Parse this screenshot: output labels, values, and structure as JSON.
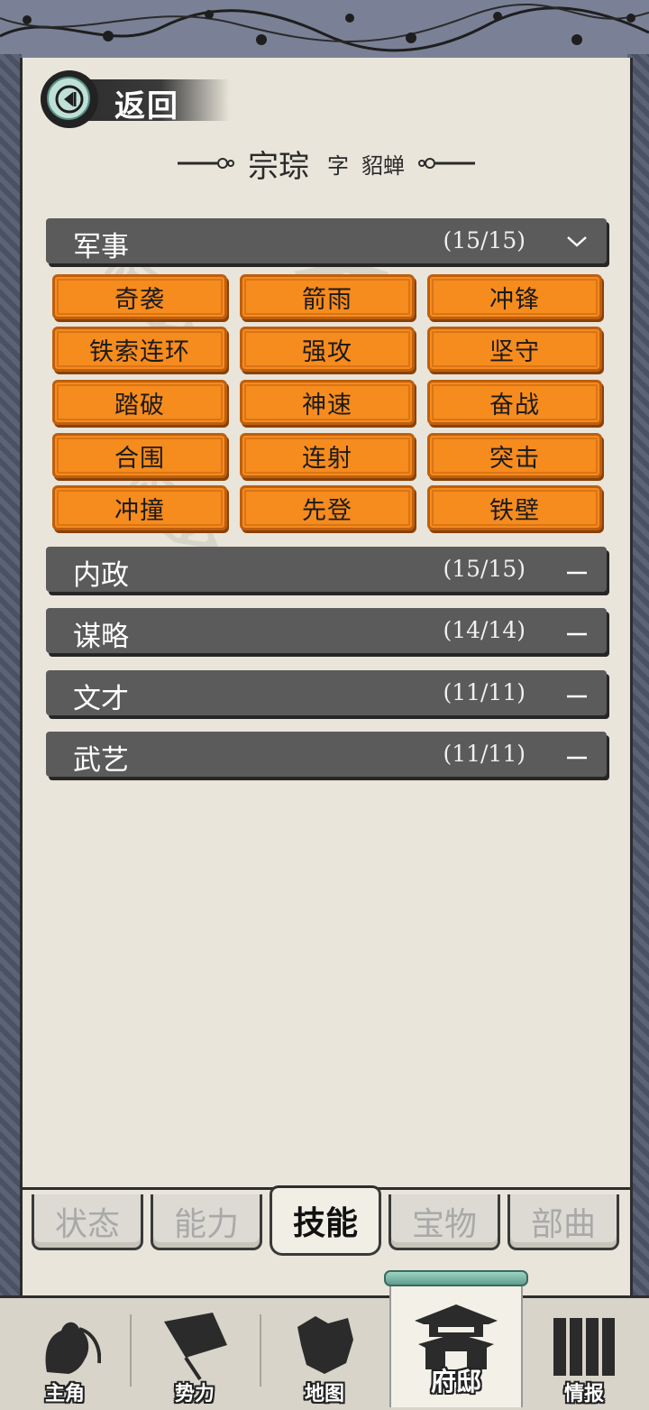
{
  "header": {
    "back_label": "返回"
  },
  "character": {
    "name": "宗琮",
    "zi_label": "字",
    "style_name": "貂蝉"
  },
  "categories": [
    {
      "name": "军事",
      "count": "(15/15)",
      "expanded": true,
      "toggle_icon": "chevron-down-icon"
    },
    {
      "name": "内政",
      "count": "(15/15)",
      "expanded": false,
      "toggle_icon": "minus-icon"
    },
    {
      "name": "谋略",
      "count": "(14/14)",
      "expanded": false,
      "toggle_icon": "minus-icon"
    },
    {
      "name": "文才",
      "count": "(11/11)",
      "expanded": false,
      "toggle_icon": "minus-icon"
    },
    {
      "name": "武艺",
      "count": "(11/11)",
      "expanded": false,
      "toggle_icon": "minus-icon"
    }
  ],
  "military_skills": [
    "奇袭",
    "箭雨",
    "冲锋",
    "铁索连环",
    "强攻",
    "坚守",
    "踏破",
    "神速",
    "奋战",
    "合围",
    "连射",
    "突击",
    "冲撞",
    "先登",
    "铁壁"
  ],
  "sub_tabs": [
    {
      "label": "状态",
      "active": false
    },
    {
      "label": "能力",
      "active": false
    },
    {
      "label": "技能",
      "active": true
    },
    {
      "label": "宝物",
      "active": false
    },
    {
      "label": "部曲",
      "active": false
    }
  ],
  "bottom_nav": [
    {
      "label": "主角",
      "icon": "hero-portrait-icon",
      "active": false
    },
    {
      "label": "势力",
      "icon": "flag-icon",
      "active": false
    },
    {
      "label": "地图",
      "icon": "map-icon",
      "active": false
    },
    {
      "label": "府邸",
      "icon": "mansion-icon",
      "active": true
    },
    {
      "label": "情报",
      "icon": "scroll-bamboo-icon",
      "active": false
    }
  ],
  "colors": {
    "skill_orange": "#f68b1e",
    "category_bar": "#5b5b5b",
    "parchment": "#e9e5da",
    "frame": "#3d4456"
  }
}
